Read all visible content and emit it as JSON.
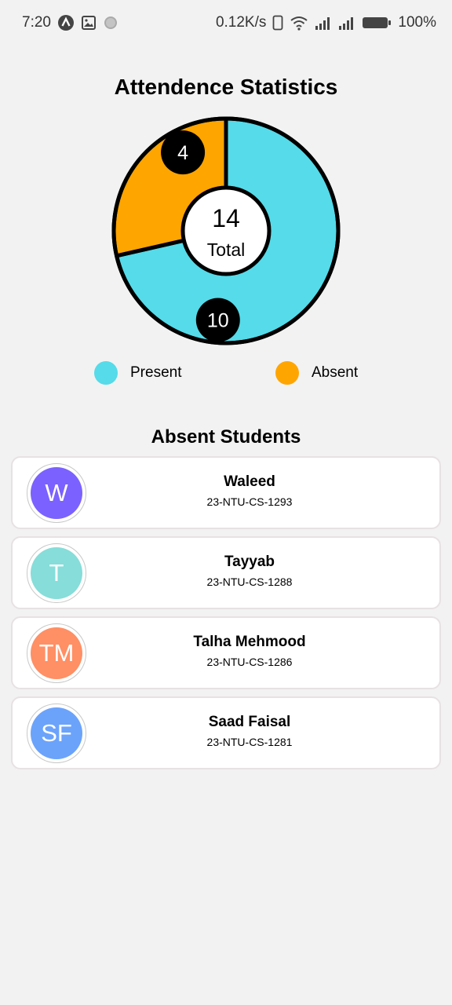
{
  "status_bar": {
    "time": "7:20",
    "network_speed": "0.12K/s",
    "battery": "100%",
    "icons": [
      "app-icon",
      "gallery-icon",
      "dot-icon",
      "phone-icon",
      "wifi-icon",
      "signal-icon",
      "signal-icon",
      "battery-icon"
    ]
  },
  "title": "Attendence Statistics",
  "chart_data": {
    "type": "pie",
    "labels": [
      "Present",
      "Absent"
    ],
    "values": [
      10,
      4
    ],
    "value_labels": [
      "10",
      "4"
    ],
    "colors": [
      "#55dbe9",
      "#ffa500"
    ],
    "center_value": "14",
    "center_label": "Total",
    "legend_position": "bottom"
  },
  "section_title": "Absent Students",
  "students": [
    {
      "initials": "W",
      "name": "Waleed",
      "id": "23-NTU-CS-1293",
      "color": "#7b61ff"
    },
    {
      "initials": "T",
      "name": "Tayyab",
      "id": "23-NTU-CS-1288",
      "color": "#86ddd9"
    },
    {
      "initials": "TM",
      "name": "Talha Mehmood",
      "id": "23-NTU-CS-1286",
      "color": "#ff8f64"
    },
    {
      "initials": "SF",
      "name": "Saad Faisal",
      "id": "23-NTU-CS-1281",
      "color": "#6ba3fb"
    }
  ]
}
